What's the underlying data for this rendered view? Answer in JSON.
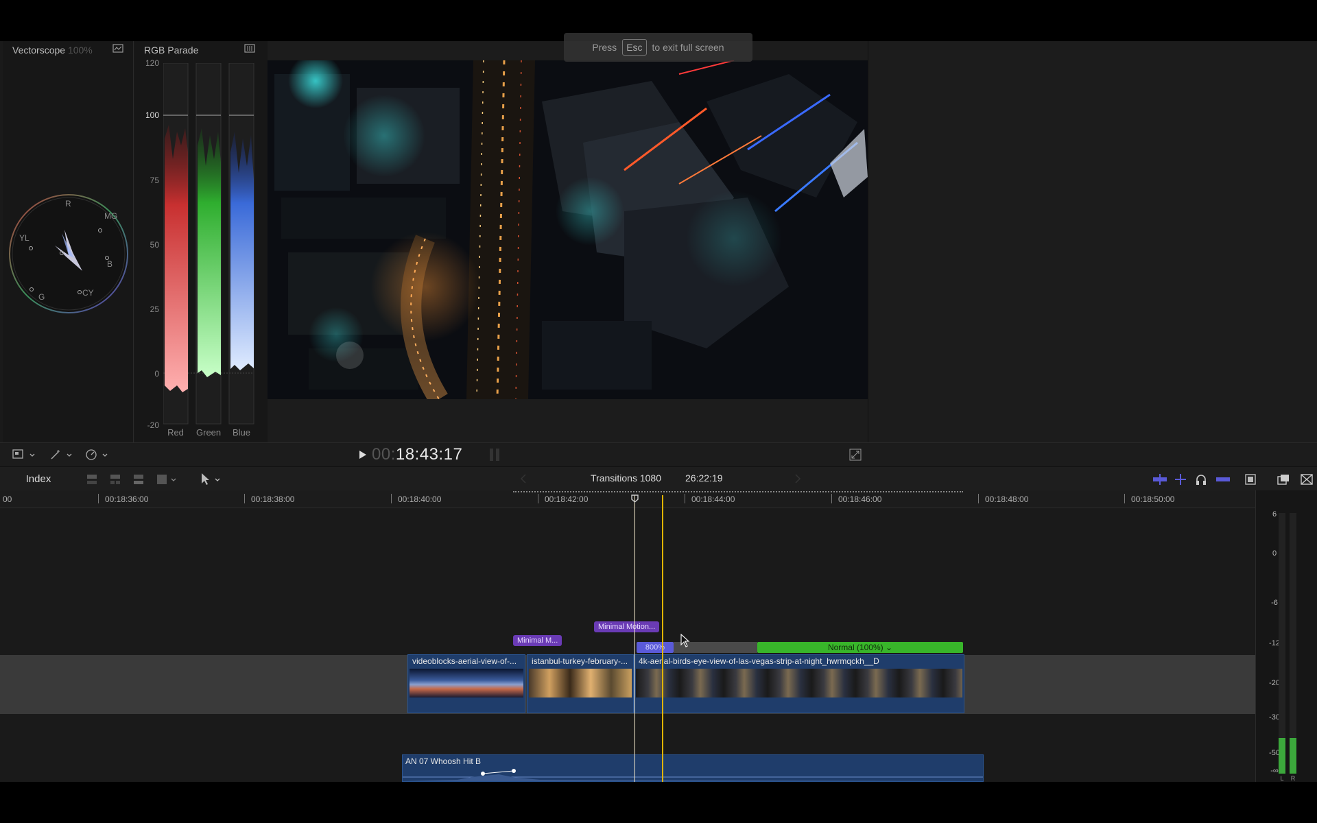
{
  "esc_hint": {
    "before": "Press",
    "key": "Esc",
    "after": "to exit full screen"
  },
  "vectorscope": {
    "title": "Vectorscope",
    "zoom": "100%",
    "targets": [
      "R",
      "MG",
      "YL",
      "B",
      "G",
      "CY"
    ]
  },
  "rgb_parade": {
    "title": "RGB Parade",
    "scale": [
      "120",
      "100",
      "75",
      "50",
      "25",
      "0",
      "-20"
    ],
    "channels": [
      "Red",
      "Green",
      "Blue"
    ]
  },
  "viewer": {
    "timecode_prefix": "00:",
    "timecode": "18:43:17"
  },
  "timeline_bar": {
    "index_label": "Index",
    "project_name": "Transitions 1080",
    "duration": "26:22:19"
  },
  "ruler": {
    "partial": "00",
    "labels": [
      "00:18:36:00",
      "00:18:38:00",
      "00:18:40:00",
      "00:18:42:00",
      "00:18:44:00",
      "00:18:46:00",
      "00:18:48:00",
      "00:18:50:00"
    ]
  },
  "transitions": {
    "first": "Minimal M...",
    "second": "Minimal Motion..."
  },
  "retime": {
    "fast": "800%",
    "normal": "Normal (100%)"
  },
  "clips": [
    {
      "title": "videoblocks-aerial-view-of-..."
    },
    {
      "title": "istanbul-turkey-february-..."
    },
    {
      "title": "4k-aerial-birds-eye-view-of-las-vegas-strip-at-night_hwrmqckh__D"
    }
  ],
  "audio_clip": {
    "title": "AN 07 Whoosh Hit B"
  },
  "audio_meter": {
    "scale": [
      "6",
      "0",
      "-6",
      "-12",
      "-20",
      "-30",
      "-50",
      "-∞"
    ],
    "channels": [
      "L",
      "R"
    ]
  },
  "colors": {
    "accent_blue": "#5a5ad8",
    "retime_green": "#38b52a",
    "transition_purple": "#6a3bb5",
    "playhead_yellow": "#e0b400",
    "clip_blue": "#1f3d6b"
  },
  "icons": [
    "scope-layout-icon",
    "enhance-icon",
    "speed-icon",
    "play-icon",
    "fullscreen-icon",
    "connect-clip-icon",
    "insert-clip-icon",
    "append-clip-icon",
    "overwrite-clip-icon",
    "arrow-tool-icon",
    "zoom-out-icon",
    "skimming-icon",
    "headphones-icon",
    "snapping-icon",
    "clip-appearance-icon",
    "window-icon",
    "close-icon"
  ]
}
